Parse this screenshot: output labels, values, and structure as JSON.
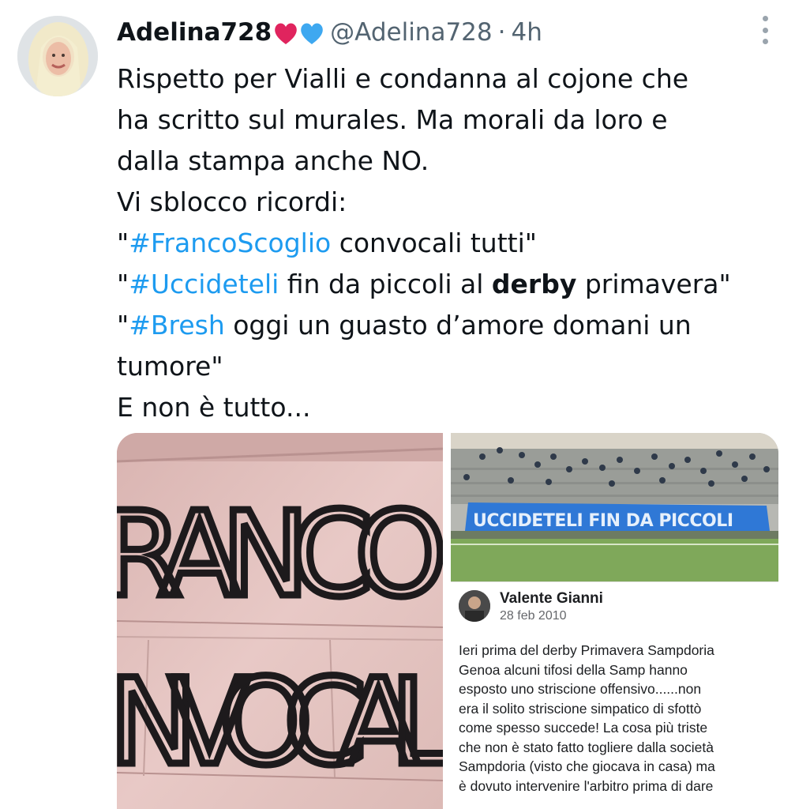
{
  "tweet": {
    "display_name": "Adelina728",
    "name_emojis": "❤️💙",
    "handle": "@Adelina728",
    "separator": "·",
    "time": "4h",
    "lines": [
      [
        {
          "t": "Rispetto per Vialli e condanna al cojone che"
        }
      ],
      [
        {
          "t": "ha scritto sul murales. Ma morali da loro e"
        }
      ],
      [
        {
          "t": "dalla stampa anche NO."
        }
      ],
      [
        {
          "t": "Vi sblocco ricordi:"
        }
      ],
      [
        {
          "t": "\""
        },
        {
          "t": "#FrancoScoglio",
          "kind": "hashtag"
        },
        {
          "t": " convocali tutti\""
        }
      ],
      [
        {
          "t": "\""
        },
        {
          "t": "#Uccideteli",
          "kind": "hashtag"
        },
        {
          "t": " fin da piccoli al "
        },
        {
          "t": "derby",
          "kind": "bold"
        },
        {
          "t": " primavera\""
        }
      ],
      [
        {
          "t": "\""
        },
        {
          "t": "#Bresh",
          "kind": "hashtag"
        },
        {
          "t": " oggi un guasto d’amore domani un"
        }
      ],
      [
        {
          "t": "tumore\""
        }
      ],
      [
        {
          "t": "E non è tutto..."
        }
      ]
    ]
  },
  "media_left": {
    "graffiti_top": "RANCO",
    "graffiti_bottom": "NVOCAL"
  },
  "media_right": {
    "banner_text": "UCCIDETELI FIN DA PICCOLI",
    "post_author": "Valente Gianni",
    "post_date": "28 feb 2010",
    "post_lines": [
      "Ieri prima del derby Primavera Sampdoria",
      "Genoa alcuni tifosi della Samp hanno",
      "esposto uno striscione offensivo......non",
      "era il solito striscione simpatico di sfottò",
      "come spesso succede! La cosa più triste",
      "che non è stato fatto togliere dalla società",
      "Sampdoria (visto che giocava in casa) ma",
      "è dovuto intervenire l'arbitro prima di dare"
    ]
  },
  "colors": {
    "hashtag": "#1d9bf0",
    "secondary_text": "#536471",
    "banner_blue": "#2f78d6",
    "pitch_green": "#7fa85a",
    "wall_pink": "#e3c3c0"
  }
}
